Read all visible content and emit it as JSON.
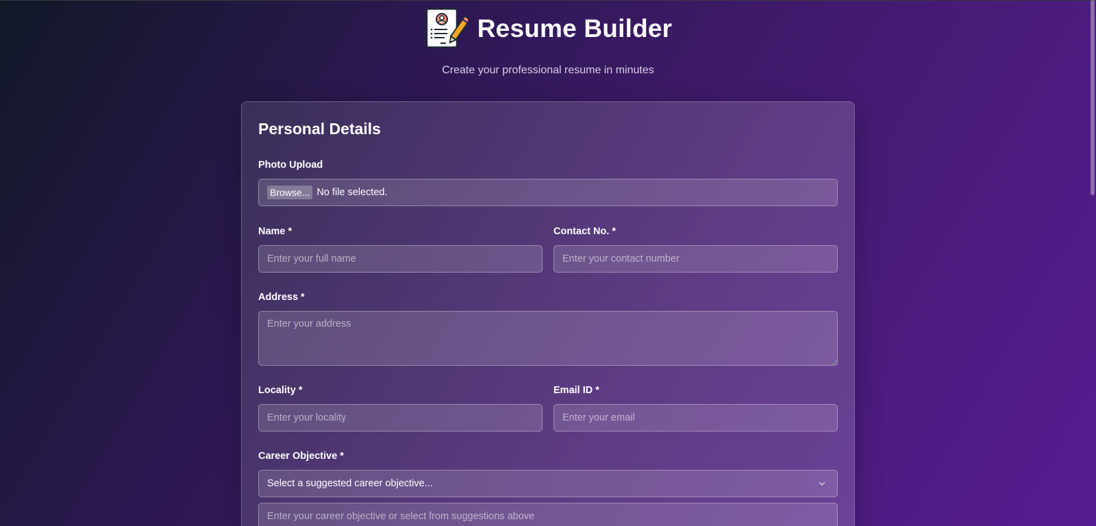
{
  "header": {
    "title": "Resume Builder",
    "subtitle": "Create your professional resume in minutes",
    "logo_icon": "resume-pencil-icon"
  },
  "form": {
    "section_title": "Personal Details",
    "photo": {
      "label": "Photo Upload",
      "button_label": "Browse...",
      "status": "No file selected."
    },
    "name": {
      "label": "Name *",
      "placeholder": "Enter your full name"
    },
    "contact": {
      "label": "Contact No. *",
      "placeholder": "Enter your contact number"
    },
    "address": {
      "label": "Address *",
      "placeholder": "Enter your address"
    },
    "locality": {
      "label": "Locality *",
      "placeholder": "Enter your locality"
    },
    "email": {
      "label": "Email ID *",
      "placeholder": "Enter your email"
    },
    "career": {
      "label": "Career Objective *",
      "select_value": "Select a suggested career objective...",
      "placeholder": "Enter your career objective or select from suggestions above"
    }
  },
  "colors": {
    "bg_start": "#111827",
    "bg_end": "#561d92",
    "text": "#ffffff"
  }
}
